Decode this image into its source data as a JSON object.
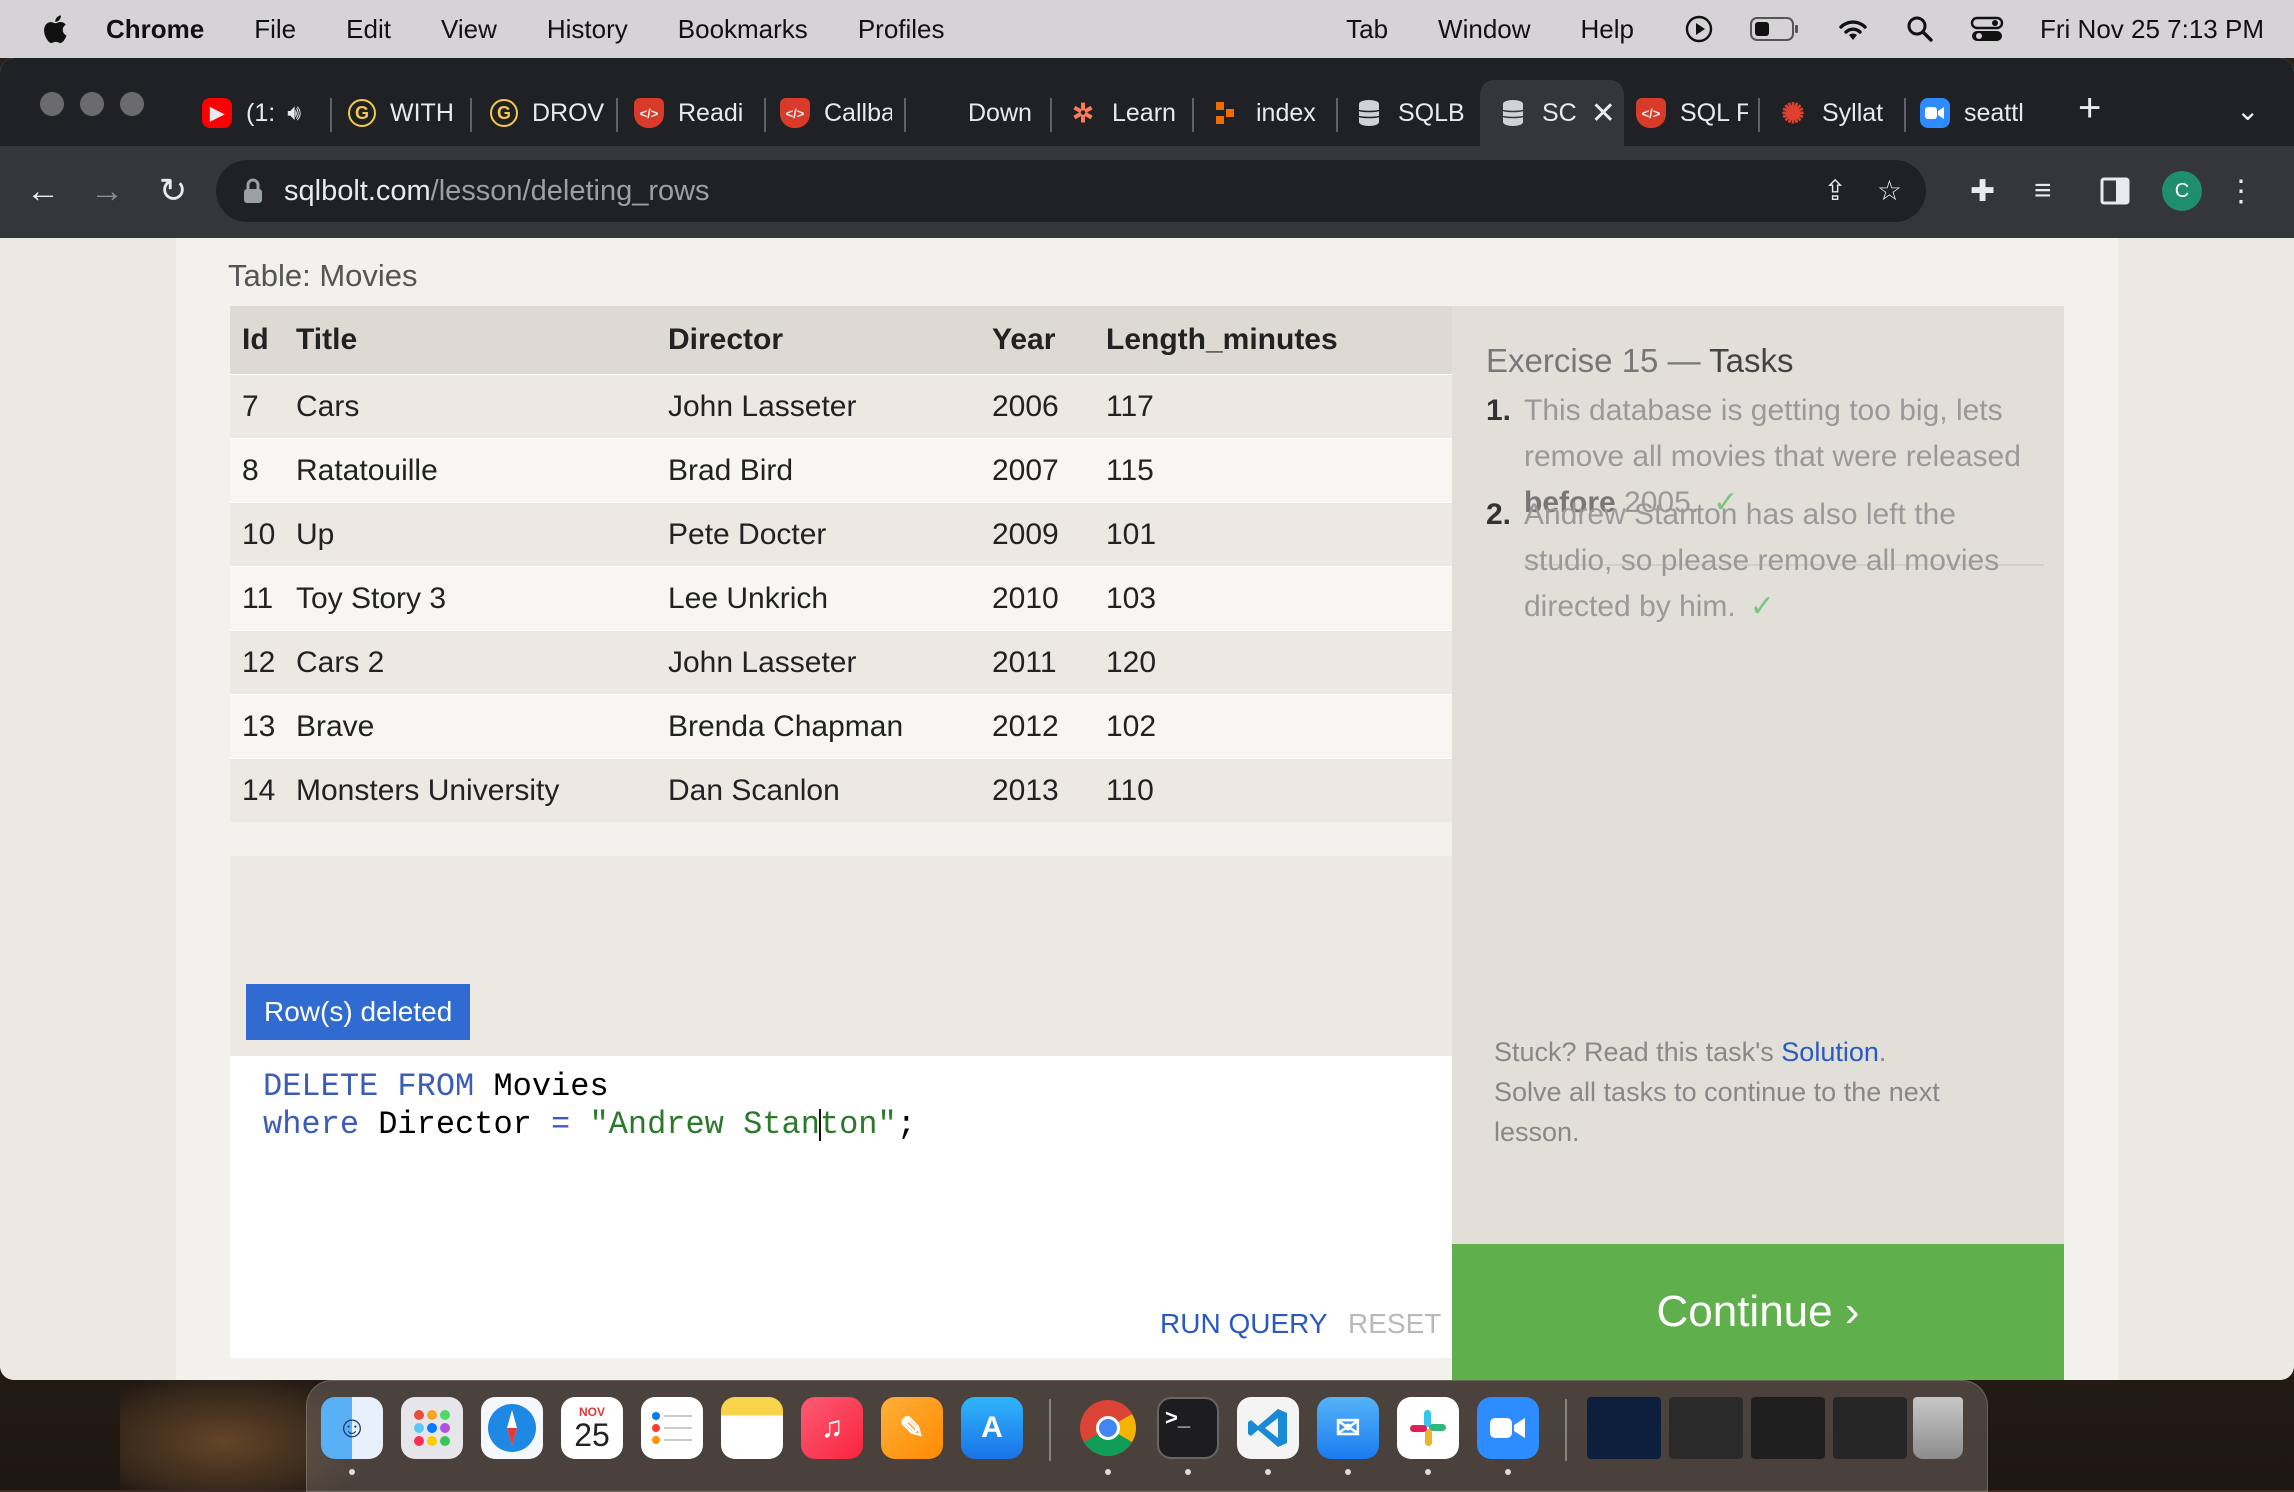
{
  "menubar": {
    "app": "Chrome",
    "items": [
      "File",
      "Edit",
      "View",
      "History",
      "Bookmarks",
      "Profiles"
    ],
    "right_items": [
      "Tab",
      "Window",
      "Help"
    ],
    "clock": "Fri Nov 25  7:13 PM"
  },
  "tabs": [
    {
      "label": "(1:",
      "icon": "youtube-icon",
      "color": "#ff0000"
    },
    {
      "label": "WITH",
      "icon": "g-icon",
      "color": "#f2c94c"
    },
    {
      "label": "DROV",
      "icon": "g-icon",
      "color": "#f2c94c"
    },
    {
      "label": "Readi",
      "icon": "code-shield-icon",
      "color": "#d93b2b"
    },
    {
      "label": "Callba",
      "icon": "code-shield-icon",
      "color": "#d93b2b"
    },
    {
      "label": "Down",
      "icon": "",
      "color": ""
    },
    {
      "label": "Learn",
      "icon": "hubspot-icon",
      "color": "#ff7a59"
    },
    {
      "label": "index",
      "icon": "dots-icon",
      "color": "#ef6c00"
    },
    {
      "label": "SQLB",
      "icon": "database-icon",
      "color": "#cfd2d6"
    },
    {
      "label": "SC",
      "icon": "database-icon",
      "color": "#cfd2d6",
      "active": true
    },
    {
      "label": "SQL F",
      "icon": "code-shield-icon",
      "color": "#d93b2b"
    },
    {
      "label": "Syllat",
      "icon": "canvas-icon",
      "color": "#e0412f"
    },
    {
      "label": "seattl",
      "icon": "zoom-icon",
      "color": "#2d8cff"
    }
  ],
  "address": {
    "domain": "sqlbolt.com",
    "path": "/lesson/deleting_rows"
  },
  "profile_initial": "C",
  "table": {
    "caption": "Table: Movies",
    "columns": [
      "Id",
      "Title",
      "Director",
      "Year",
      "Length_minutes"
    ],
    "rows": [
      [
        "7",
        "Cars",
        "John Lasseter",
        "2006",
        "117"
      ],
      [
        "8",
        "Ratatouille",
        "Brad Bird",
        "2007",
        "115"
      ],
      [
        "10",
        "Up",
        "Pete Docter",
        "2009",
        "101"
      ],
      [
        "11",
        "Toy Story 3",
        "Lee Unkrich",
        "2010",
        "103"
      ],
      [
        "12",
        "Cars 2",
        "John Lasseter",
        "2011",
        "120"
      ],
      [
        "13",
        "Brave",
        "Brenda Chapman",
        "2012",
        "102"
      ],
      [
        "14",
        "Monsters University",
        "Dan Scanlon",
        "2013",
        "110"
      ]
    ]
  },
  "status_badge": "Row(s) deleted",
  "editor": {
    "line1": {
      "kw1": "DELETE",
      "kw2": "FROM",
      "rest": "Movies"
    },
    "line2": {
      "kw": "where",
      "ident": "Director",
      "op": "=",
      "str_a": "\"Andrew Stan",
      "str_b": "ton\"",
      "end": ";"
    }
  },
  "buttons": {
    "run": "RUN QUERY",
    "reset": "RESET",
    "continue": "Continue ›"
  },
  "exercise": {
    "title_a": "Exercise 15 — ",
    "title_b": "Tasks",
    "tasks": [
      {
        "num": "1.",
        "pre": "This database is getting too big, lets remove all movies that were released ",
        "bold": "before",
        "post": " 2005.",
        "check": "✓"
      },
      {
        "num": "2.",
        "pre": "Andrew Stanton has also left the studio, so please remove all movies directed by him.",
        "bold": "",
        "post": "",
        "check": "✓"
      }
    ],
    "stuck_pre": "Stuck? Read this task's ",
    "stuck_link": "Solution",
    "stuck_post": ".",
    "stuck_line2": "Solve all tasks to continue to the next lesson."
  },
  "dock": {
    "calendar_month": "NOV",
    "calendar_day": "25",
    "apps": [
      "finder",
      "launchpad",
      "safari",
      "calendar",
      "reminders",
      "notes",
      "music",
      "pages",
      "app-store",
      "chrome",
      "terminal",
      "vscode",
      "mail",
      "slack",
      "zoom"
    ]
  }
}
